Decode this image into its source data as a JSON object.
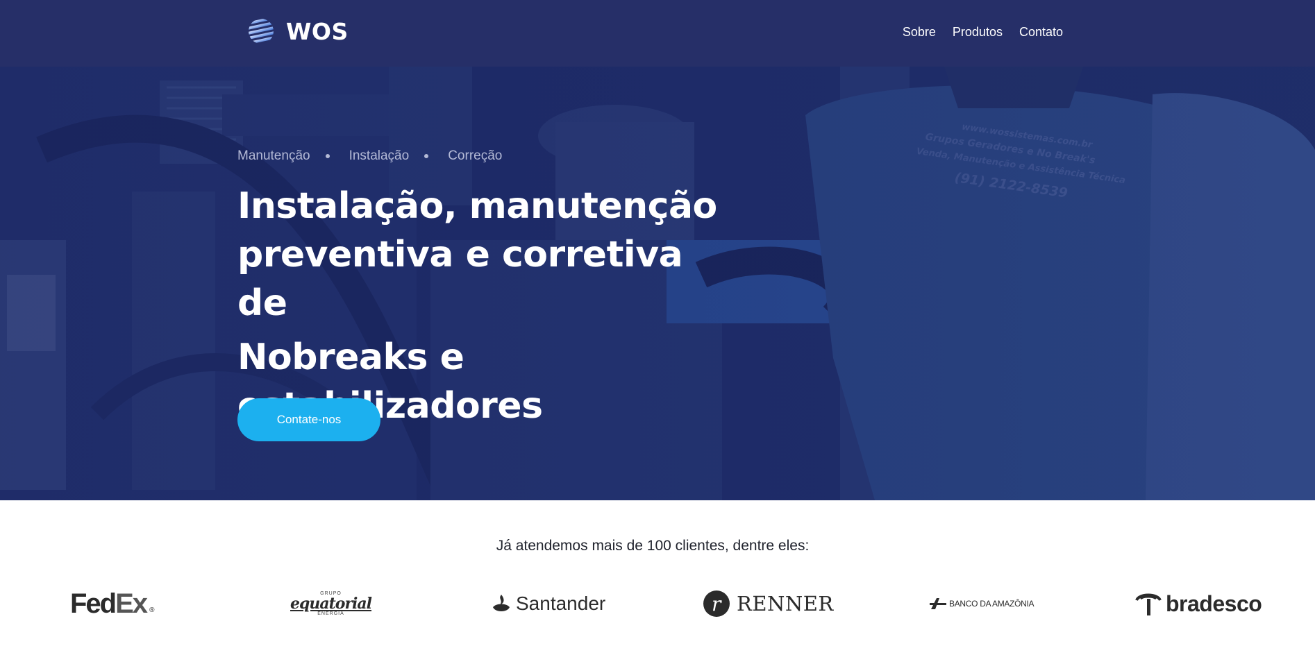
{
  "header": {
    "brand": "WOS",
    "nav": [
      {
        "label": "Sobre"
      },
      {
        "label": "Produtos"
      },
      {
        "label": "Contato"
      }
    ]
  },
  "hero": {
    "tags": [
      "Manutenção",
      "Instalação",
      "Correção"
    ],
    "headline_line1": "Instalação, manutenção preventiva e corretiva de",
    "headline_line2": "Nobreaks e estabilizadores",
    "cta_label": "Contate-nos",
    "background_shirt_text": [
      "www.wossistemas.com.br",
      "Grupos Geradores e No Break's",
      "Venda, Manutenção e Assistência Técnica",
      "(91) 2122-8539"
    ]
  },
  "clients": {
    "title": "Já atendemos mais de 100 clientes, dentre eles:",
    "logos": [
      {
        "name": "FedEx",
        "text_a": "Fed",
        "text_b": "Ex",
        "mark": "®"
      },
      {
        "name": "Equatorial",
        "top": "GRUPO",
        "main": "equatorial",
        "bottom": "ENERGIA"
      },
      {
        "name": "Santander",
        "text": "Santander"
      },
      {
        "name": "Renner",
        "badge": "r",
        "text": "RENNER"
      },
      {
        "name": "Banco da Amazônia",
        "text": "BANCO DA AMAZÔNIA"
      },
      {
        "name": "Bradesco",
        "text": "bradesco"
      }
    ]
  },
  "colors": {
    "header_bg": "#262f68",
    "hero_overlay": "#24346f",
    "cta_bg": "#1cb0ef",
    "tag_text": "#b4bad6"
  }
}
